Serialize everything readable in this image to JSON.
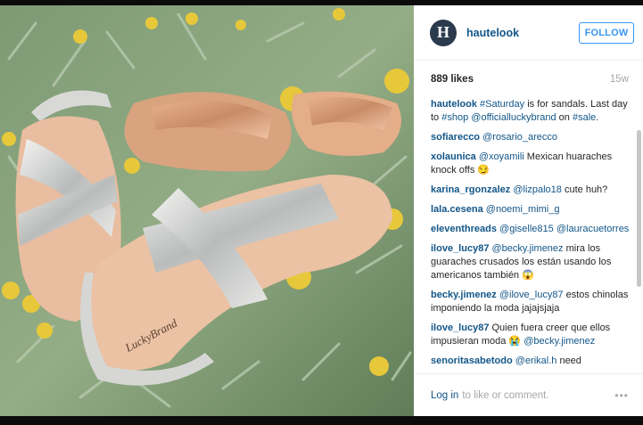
{
  "post": {
    "username": "hautelook",
    "avatar_letter": "H",
    "follow_label": "FOLLOW",
    "likes": "889 likes",
    "age": "15w",
    "photo_brand_text": "LuckyBrand"
  },
  "caption": {
    "user": "hautelook",
    "parts": [
      " ",
      "#Saturday",
      " is for sandals. Last day to ",
      "#shop",
      " ",
      "@officialluckybrand",
      " on ",
      "#sale",
      "."
    ]
  },
  "comments": [
    {
      "user": "sofiarecco",
      "parts": [
        " ",
        "@rosario_arecco"
      ]
    },
    {
      "user": "xolaunica",
      "parts": [
        " ",
        "@xoyamili",
        " Mexican huaraches knock offs 😏"
      ]
    },
    {
      "user": "karina_rgonzalez",
      "parts": [
        " ",
        "@lizpalo18",
        " cute huh?"
      ]
    },
    {
      "user": "lala.cesena",
      "parts": [
        " ",
        "@noemi_mimi_g"
      ]
    },
    {
      "user": "eleventhreads",
      "parts": [
        " ",
        "@giselle815",
        " ",
        "@lauracuetorres"
      ]
    },
    {
      "user": "ilove_lucy87",
      "parts": [
        " ",
        "@becky.jimenez",
        " mira los guaraches crusados los están usando los americanos también 😱"
      ]
    },
    {
      "user": "becky.jimenez",
      "parts": [
        " ",
        "@ilove_lucy87",
        " estos chinolas imponiendo la moda jajajsjaja"
      ]
    },
    {
      "user": "ilove_lucy87",
      "parts": [
        " Quien fuera creer que ellos impusieran moda 😭 ",
        "@becky.jimenez"
      ]
    },
    {
      "user": "senoritasabetodo",
      "parts": [
        " ",
        "@erikal.h",
        " need"
      ]
    }
  ],
  "footer": {
    "login_label": "Log in",
    "login_suffix": "to like or comment.",
    "more_icon": "•••"
  },
  "colors": {
    "link_blue": "#125688",
    "follow_blue": "#3897f0",
    "muted_gray": "#a5a7aa"
  }
}
